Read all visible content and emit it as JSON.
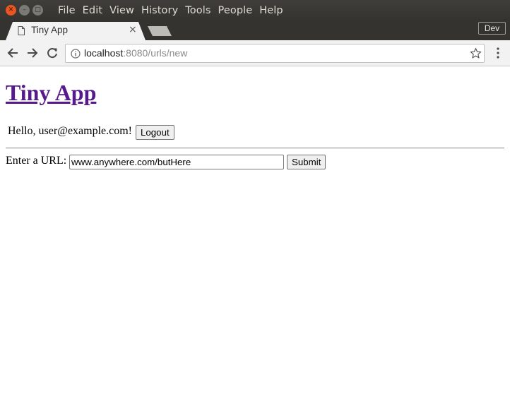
{
  "window": {
    "menu": [
      "File",
      "Edit",
      "View",
      "History",
      "Tools",
      "People",
      "Help"
    ]
  },
  "tabs": {
    "active_title": "Tiny App",
    "close_glyph": "×",
    "profile_label": "Dev"
  },
  "toolbar": {
    "url_host": "localhost",
    "url_rest": ":8080/urls/new"
  },
  "page": {
    "heading": "Tiny App",
    "greeting": "Hello, user@example.com!",
    "logout_label": "Logout",
    "url_label": "Enter a URL:",
    "url_value": "www.anywhere.com/butHere",
    "submit_label": "Submit"
  },
  "colors": {
    "titlebar": "#3f3e3a",
    "close_button": "#e95420",
    "visited_link": "#551a8b"
  },
  "icons": [
    "page-icon",
    "back-icon",
    "forward-icon",
    "reload-icon",
    "info-icon",
    "star-icon",
    "menu-icon"
  ]
}
